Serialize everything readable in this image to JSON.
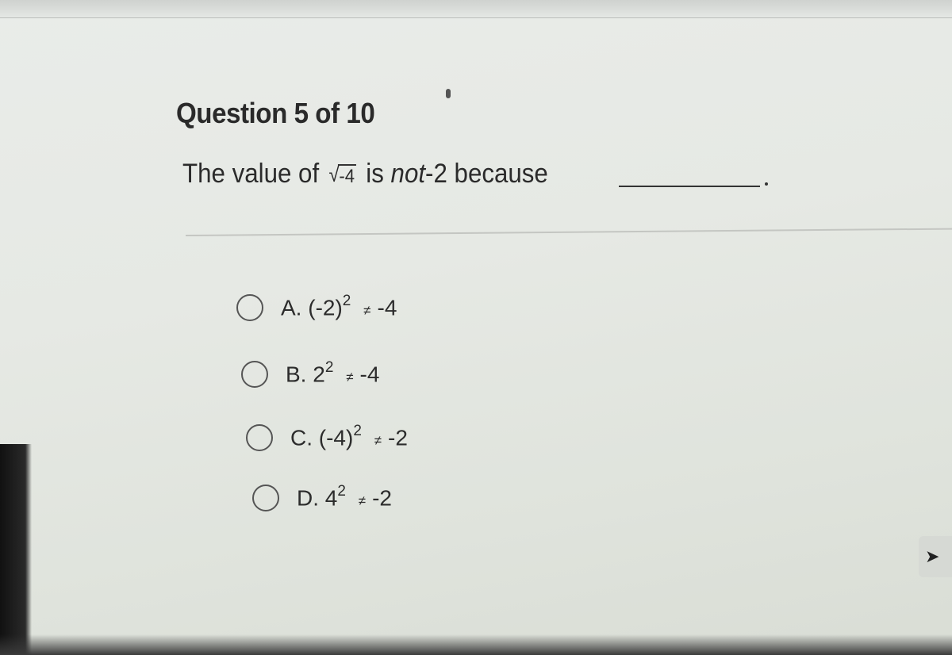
{
  "question": {
    "header": "Question 5 of 10",
    "prompt": {
      "before": "The value of",
      "radicand": "-4",
      "after_mid": "is",
      "emphasis": "not",
      "after": "-2 because"
    }
  },
  "options": [
    {
      "letter": "A.",
      "base": "(-2)",
      "exp": "2",
      "neq": "≠",
      "rhs": "-4",
      "selected": false
    },
    {
      "letter": "B.",
      "base": "2",
      "exp": "2",
      "neq": "≠",
      "rhs": "-4",
      "selected": false
    },
    {
      "letter": "C.",
      "base": "(-4)",
      "exp": "2",
      "neq": "≠",
      "rhs": "-2",
      "selected": false
    },
    {
      "letter": "D.",
      "base": "4",
      "exp": "2",
      "neq": "≠",
      "rhs": "-2",
      "selected": false
    }
  ],
  "next_button": {
    "icon": "arrow-icon",
    "glyph": "➤"
  },
  "colors": {
    "background": "#e6e9e4",
    "text": "#222222",
    "radio_border": "#555555"
  }
}
